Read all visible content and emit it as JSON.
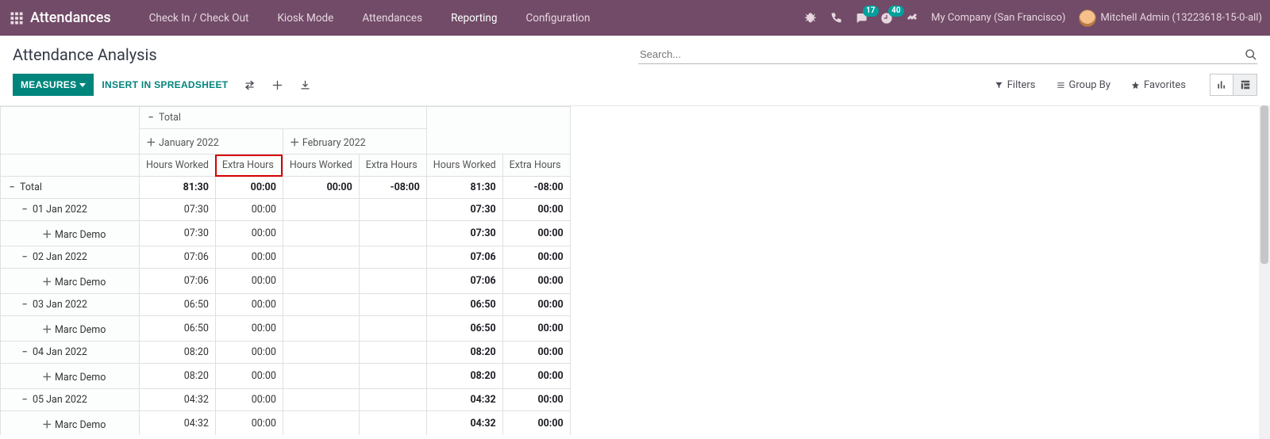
{
  "nav": {
    "brand": "Attendances",
    "items": [
      "Check In / Check Out",
      "Kiosk Mode",
      "Attendances",
      "Reporting",
      "Configuration"
    ],
    "msg_badge": "17",
    "activity_badge": "40",
    "company": "My Company (San Francisco)",
    "user": "Mitchell Admin (13223618-15-0-all)"
  },
  "page": {
    "title": "Attendance Analysis",
    "search_placeholder": "Search..."
  },
  "controls": {
    "measures": "MEASURES",
    "insert": "INSERT IN SPREADSHEET",
    "filters": "Filters",
    "groupby": "Group By",
    "favorites": "Favorites"
  },
  "pivot": {
    "total_label": "Total",
    "months": [
      {
        "label": "January 2022"
      },
      {
        "label": "February 2022"
      }
    ],
    "measure_labels": [
      "Hours Worked",
      "Extra Hours"
    ],
    "rows": [
      {
        "level": 0,
        "icon": "minus",
        "label": "Total",
        "jan_hw": "81:30",
        "jan_eh": "00:00",
        "feb_hw": "00:00",
        "feb_eh": "-08:00",
        "tot_hw": "81:30",
        "tot_eh": "-08:00",
        "strong": true
      },
      {
        "level": 1,
        "icon": "minus",
        "label": "01 Jan 2022",
        "jan_hw": "07:30",
        "jan_eh": "00:00",
        "feb_hw": "",
        "feb_eh": "",
        "tot_hw": "07:30",
        "tot_eh": "00:00"
      },
      {
        "level": 2,
        "icon": "plus",
        "label": "Marc Demo",
        "jan_hw": "07:30",
        "jan_eh": "00:00",
        "feb_hw": "",
        "feb_eh": "",
        "tot_hw": "07:30",
        "tot_eh": "00:00"
      },
      {
        "level": 1,
        "icon": "minus",
        "label": "02 Jan 2022",
        "jan_hw": "07:06",
        "jan_eh": "00:00",
        "feb_hw": "",
        "feb_eh": "",
        "tot_hw": "07:06",
        "tot_eh": "00:00"
      },
      {
        "level": 2,
        "icon": "plus",
        "label": "Marc Demo",
        "jan_hw": "07:06",
        "jan_eh": "00:00",
        "feb_hw": "",
        "feb_eh": "",
        "tot_hw": "07:06",
        "tot_eh": "00:00"
      },
      {
        "level": 1,
        "icon": "minus",
        "label": "03 Jan 2022",
        "jan_hw": "06:50",
        "jan_eh": "00:00",
        "feb_hw": "",
        "feb_eh": "",
        "tot_hw": "06:50",
        "tot_eh": "00:00"
      },
      {
        "level": 2,
        "icon": "plus",
        "label": "Marc Demo",
        "jan_hw": "06:50",
        "jan_eh": "00:00",
        "feb_hw": "",
        "feb_eh": "",
        "tot_hw": "06:50",
        "tot_eh": "00:00"
      },
      {
        "level": 1,
        "icon": "minus",
        "label": "04 Jan 2022",
        "jan_hw": "08:20",
        "jan_eh": "00:00",
        "feb_hw": "",
        "feb_eh": "",
        "tot_hw": "08:20",
        "tot_eh": "00:00"
      },
      {
        "level": 2,
        "icon": "plus",
        "label": "Marc Demo",
        "jan_hw": "08:20",
        "jan_eh": "00:00",
        "feb_hw": "",
        "feb_eh": "",
        "tot_hw": "08:20",
        "tot_eh": "00:00"
      },
      {
        "level": 1,
        "icon": "minus",
        "label": "05 Jan 2022",
        "jan_hw": "04:32",
        "jan_eh": "00:00",
        "feb_hw": "",
        "feb_eh": "",
        "tot_hw": "04:32",
        "tot_eh": "00:00"
      },
      {
        "level": 2,
        "icon": "plus",
        "label": "Marc Demo",
        "jan_hw": "04:32",
        "jan_eh": "00:00",
        "feb_hw": "",
        "feb_eh": "",
        "tot_hw": "04:32",
        "tot_eh": "00:00"
      }
    ]
  }
}
